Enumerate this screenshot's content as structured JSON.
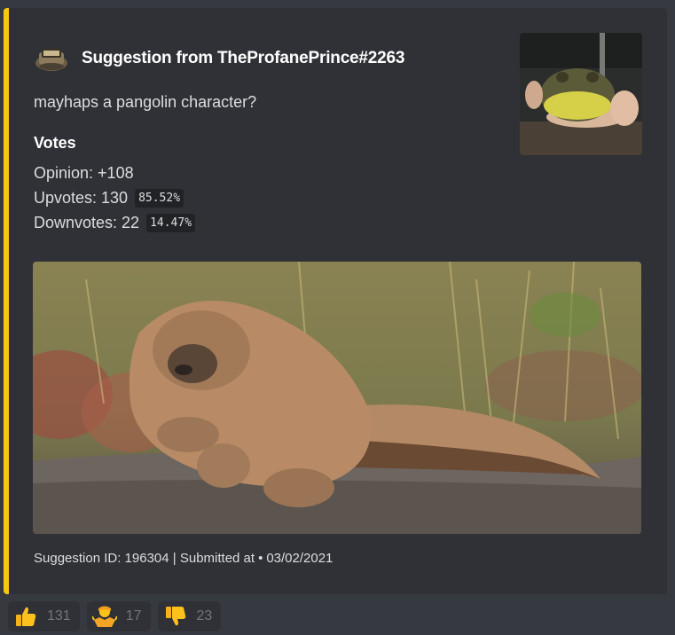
{
  "embed": {
    "accent_color": "#f7c812",
    "author": {
      "name": "Suggestion from TheProfanePrince#2263",
      "avatar_icon": "tray-avatar-icon"
    },
    "description": "mayhaps a pangolin character?",
    "field": {
      "name": "Votes",
      "opinion": "Opinion: +108",
      "upvotes": "Upvotes: 130",
      "upvotes_pct": "85.52%",
      "downvotes": "Downvotes: 22",
      "downvotes_pct": "14.47%"
    },
    "thumbnail_icon": "frog-thumbnail-image",
    "image_icon": "pangolin-image",
    "footer": {
      "suggestion_id": "Suggestion ID: 196304 | Submitted at",
      "bullet": "•",
      "date": "03/02/2021"
    }
  },
  "reactions": [
    {
      "icon": "thumbs-up-icon",
      "count": "131"
    },
    {
      "icon": "person-shrug-icon",
      "count": "17"
    },
    {
      "icon": "thumbs-down-icon",
      "count": "23"
    }
  ]
}
